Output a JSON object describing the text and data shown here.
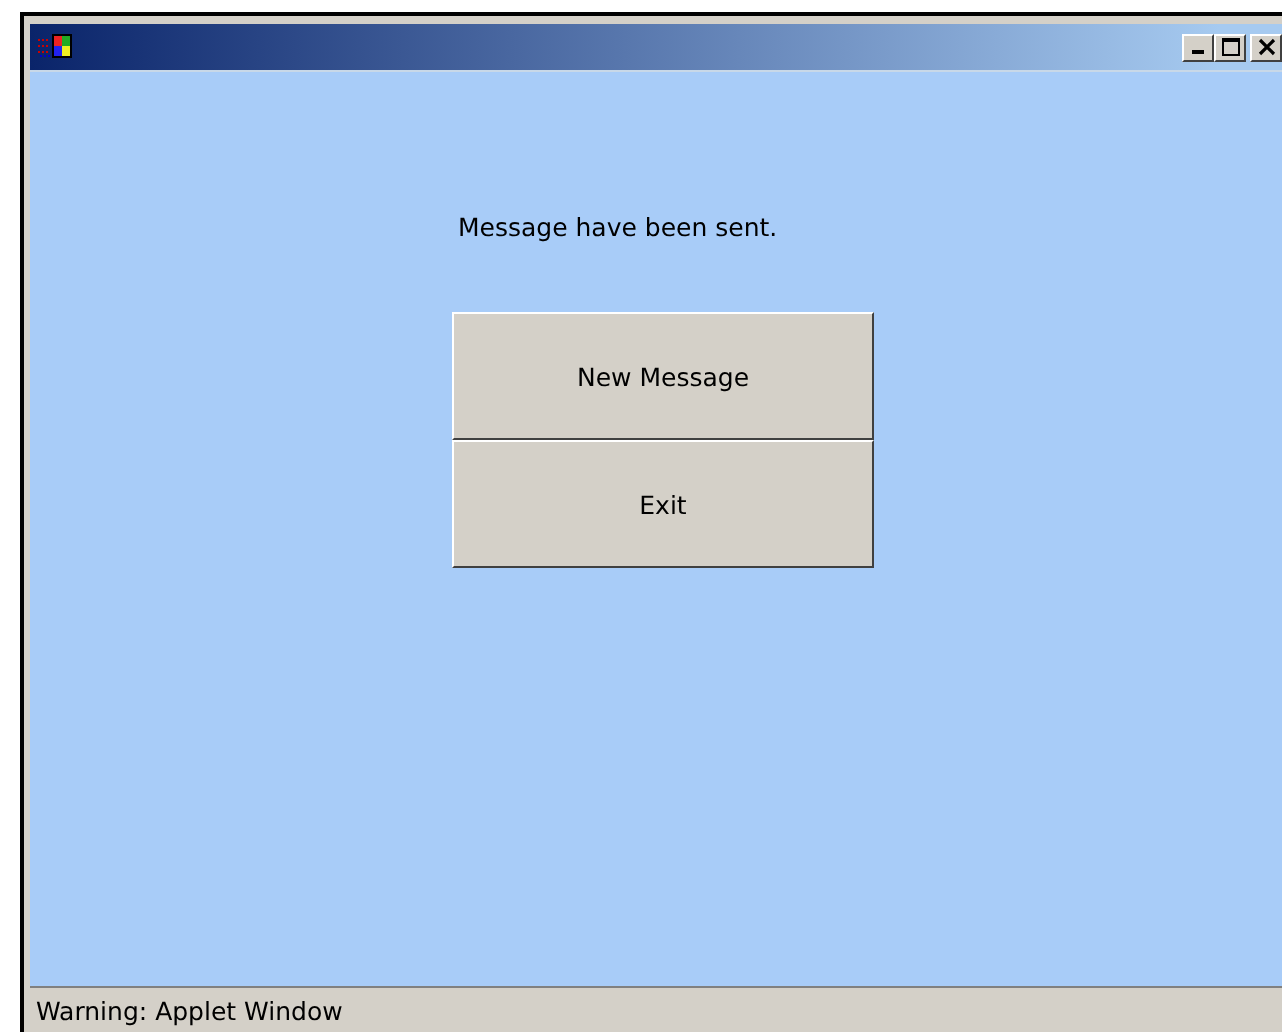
{
  "window": {
    "title_buttons": [
      {
        "kind": "minimize"
      },
      {
        "kind": "maximize"
      },
      {
        "kind": "close"
      }
    ]
  },
  "message": "Message have been sent.",
  "buttons": [
    "New Message",
    "Exit"
  ],
  "status_bar": "Warning: Applet Window"
}
